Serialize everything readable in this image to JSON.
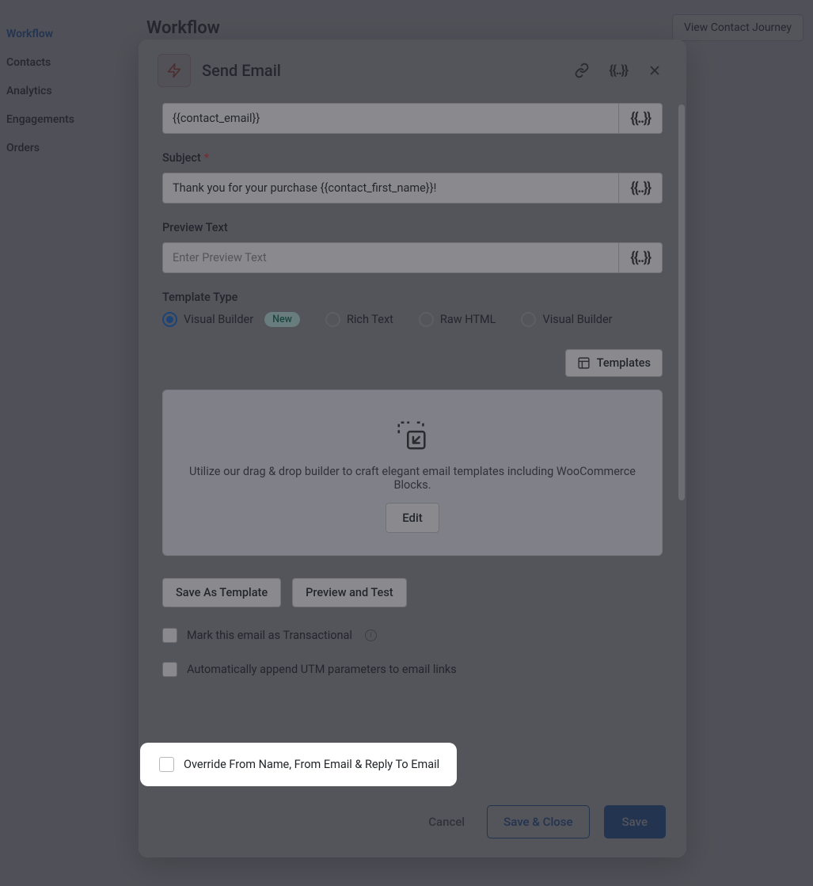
{
  "sidebar": {
    "items": [
      {
        "label": "Workflow",
        "active": true
      },
      {
        "label": "Contacts"
      },
      {
        "label": "Analytics"
      },
      {
        "label": "Engagements"
      },
      {
        "label": "Orders"
      }
    ]
  },
  "page": {
    "title": "Workflow",
    "view_journey": "View Contact Journey"
  },
  "modal": {
    "title": "Send Email",
    "to_value": "{{contact_email}}",
    "subject_label": "Subject",
    "subject_value": "Thank you for your purchase {{contact_first_name}}!",
    "preview_label": "Preview Text",
    "preview_placeholder": "Enter Preview Text",
    "template_type_label": "Template Type",
    "radios": {
      "visual_builder": "Visual Builder",
      "new_badge": "New",
      "rich_text": "Rich Text",
      "raw_html": "Raw HTML",
      "visual_builder_2": "Visual Builder"
    },
    "templates_btn": "Templates",
    "builder_desc": "Utilize our drag & drop builder to craft elegant email templates including WooCommerce Blocks.",
    "edit_btn": "Edit",
    "save_as_template": "Save As Template",
    "preview_test": "Preview and Test",
    "check_transactional": "Mark this email as Transactional",
    "check_utm": "Automatically append UTM parameters to email links",
    "check_override": "Override From Name, From Email & Reply To Email",
    "footer": {
      "cancel": "Cancel",
      "save_close": "Save & Close",
      "save": "Save"
    }
  }
}
